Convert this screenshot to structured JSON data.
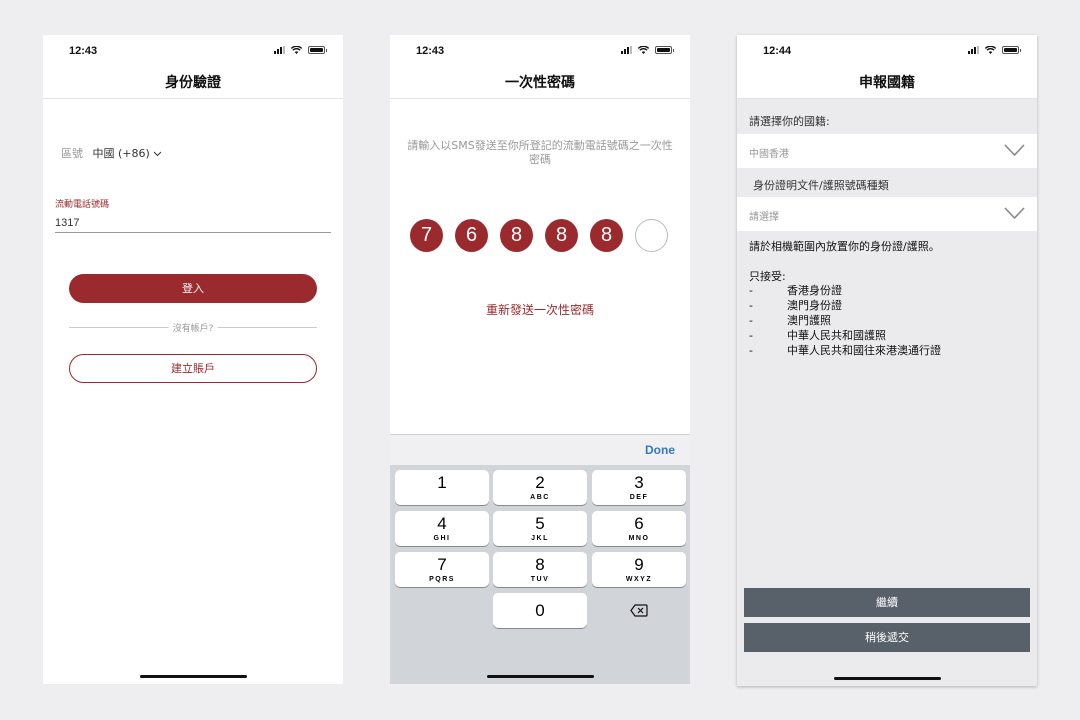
{
  "phone1": {
    "time": "12:43",
    "title": "身份驗證",
    "region_label": "區號",
    "region_value": "中國 (+86)",
    "phone_label": "流動電話號碼",
    "phone_value": "1317",
    "login_button": "登入",
    "no_account": "沒有帳戶?",
    "create_button": "建立賬戶"
  },
  "phone2": {
    "time": "12:43",
    "title": "一次性密碼",
    "instruction": "請輸入以SMS發送至你所登記的流動電話號碼之一次性密碼",
    "otp_digits": [
      "7",
      "6",
      "8",
      "8",
      "8",
      ""
    ],
    "resend": "重新發送一次性密碼",
    "keyboard": {
      "done": "Done",
      "keys": [
        {
          "num": "1",
          "letters": ""
        },
        {
          "num": "2",
          "letters": "ABC"
        },
        {
          "num": "3",
          "letters": "DEF"
        },
        {
          "num": "4",
          "letters": "GHI"
        },
        {
          "num": "5",
          "letters": "JKL"
        },
        {
          "num": "6",
          "letters": "MNO"
        },
        {
          "num": "7",
          "letters": "PQRS"
        },
        {
          "num": "8",
          "letters": "TUV"
        },
        {
          "num": "9",
          "letters": "WXYZ"
        },
        {
          "num": "0",
          "letters": ""
        }
      ]
    }
  },
  "phone3": {
    "time": "12:44",
    "title": "申報國籍",
    "nationality_label": "請選擇你的國籍:",
    "nationality_value": "中國香港",
    "doc_type_label": "身份證明文件/護照號碼種類",
    "doc_type_value": "請選擇",
    "id_note": "請於相機範圍內放置你的身份證/護照。",
    "accept_label": "只接受:",
    "accepted": [
      "香港身份證",
      "澳門身份證",
      "澳門護照",
      "中華人民共和國護照",
      "中華人民共和國往來港澳通行證"
    ],
    "continue_button": "繼續",
    "later_button": "稍後遞交"
  }
}
